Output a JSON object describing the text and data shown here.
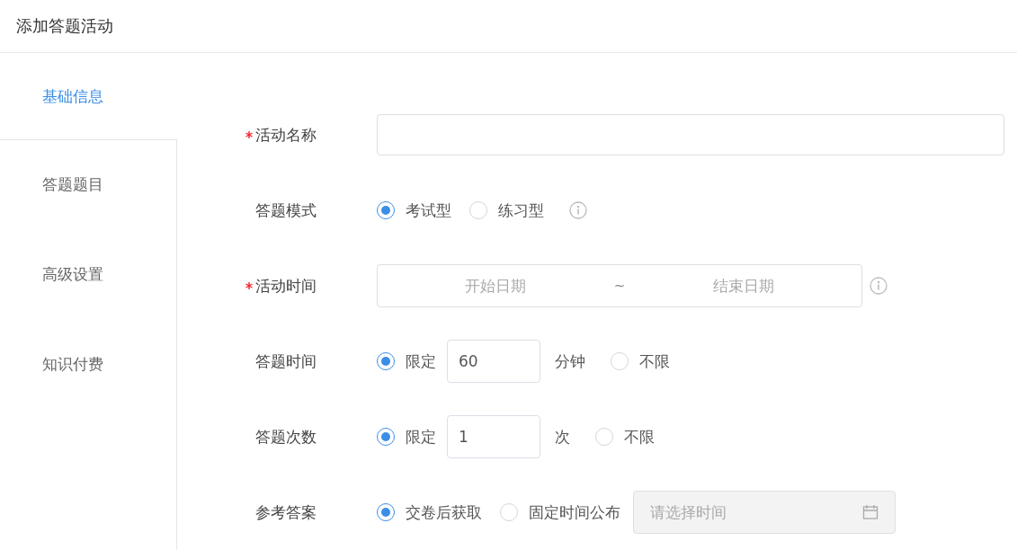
{
  "page": {
    "title": "添加答题活动"
  },
  "sidebar": {
    "items": [
      {
        "label": "基础信息",
        "selected": true
      },
      {
        "label": "答题题目",
        "selected": false
      },
      {
        "label": "高级设置",
        "selected": false
      },
      {
        "label": "知识付费",
        "selected": false
      }
    ]
  },
  "form": {
    "rows": [
      {
        "kind": "text",
        "label": "活动名称",
        "required": true
      },
      {
        "kind": "radio",
        "label": "答题模式",
        "required": false,
        "info": true,
        "options": [
          {
            "label": "考试型",
            "selected": true
          },
          {
            "label": "练习型",
            "selected": false
          }
        ]
      },
      {
        "kind": "daterange",
        "label": "活动时间",
        "required": true,
        "info": true,
        "start_placeholder": "开始日期",
        "separator": "~",
        "end_placeholder": "结束日期"
      },
      {
        "kind": "radio",
        "label": "答题时间",
        "required": false,
        "info": false,
        "options": [
          {
            "label": "限定",
            "selected": true,
            "value": "60",
            "unit": "分钟"
          },
          {
            "label": "不限",
            "selected": false
          }
        ]
      },
      {
        "kind": "radio",
        "label": "答题次数",
        "required": false,
        "info": false,
        "options": [
          {
            "label": "限定",
            "selected": true,
            "value": "1",
            "unit": "次"
          },
          {
            "label": "不限",
            "selected": false
          }
        ]
      },
      {
        "kind": "radio",
        "label": "参考答案",
        "required": false,
        "info": false,
        "options": [
          {
            "label": "交卷后获取",
            "selected": true
          },
          {
            "label": "固定时间公布",
            "selected": false,
            "picker_placeholder": "请选择时间",
            "disabled": true
          }
        ]
      }
    ]
  }
}
